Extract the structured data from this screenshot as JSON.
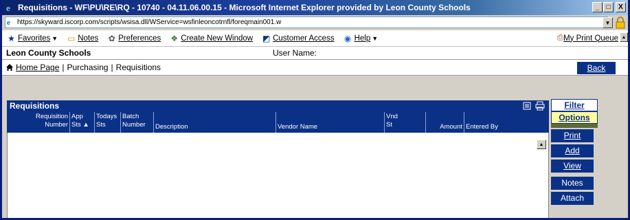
{
  "window": {
    "title": "Requisitions - WF\\PU\\RE\\RQ - 10740 - 04.11.06.00.15 - Microsoft Internet Explorer provided by Leon County Schools",
    "minimize": "_",
    "maximize": "□",
    "close": "X"
  },
  "address": {
    "url": "https://skyward.iscorp.com/scripts/wsisa.dll/WService=wsfinleoncotrnfl/foreqmain001.w"
  },
  "links": {
    "favorites": "Favorites",
    "notes": "Notes",
    "preferences": "Preferences",
    "create_window": "Create New Window",
    "customer_access": "Customer Access",
    "help": "Help",
    "print_queue": "My Print Queue"
  },
  "org": {
    "name": "Leon County Schools",
    "user_label": "User Name:"
  },
  "breadcrumb": {
    "home": "Home Page",
    "purchasing": "Purchasing",
    "requisitions": "Requisitions",
    "separator": "|",
    "back": "Back"
  },
  "panel": {
    "title": "Requisitions",
    "columns": [
      {
        "line1": "Requisition",
        "line2": "Number"
      },
      {
        "line1": "App",
        "line2": "Sts ▲"
      },
      {
        "line1": "Todays",
        "line2": "Sts"
      },
      {
        "line1": "Batch",
        "line2": "Number"
      },
      {
        "line1": "",
        "line2": "Description"
      },
      {
        "line1": "",
        "line2": "Vendor Name"
      },
      {
        "line1": "Vnd",
        "line2": "St"
      },
      {
        "line1": "",
        "line2": "Amount"
      },
      {
        "line1": "",
        "line2": "Entered By"
      }
    ]
  },
  "actions": {
    "filter": "Filter",
    "options": "Options",
    "print": "Print",
    "add": "Add",
    "view": "View",
    "notes": "Notes",
    "attach": "Attach"
  },
  "colors": {
    "title_bar": "#0a246a",
    "header_blue": "#0b3187",
    "options_highlight": "#fffb9c"
  }
}
